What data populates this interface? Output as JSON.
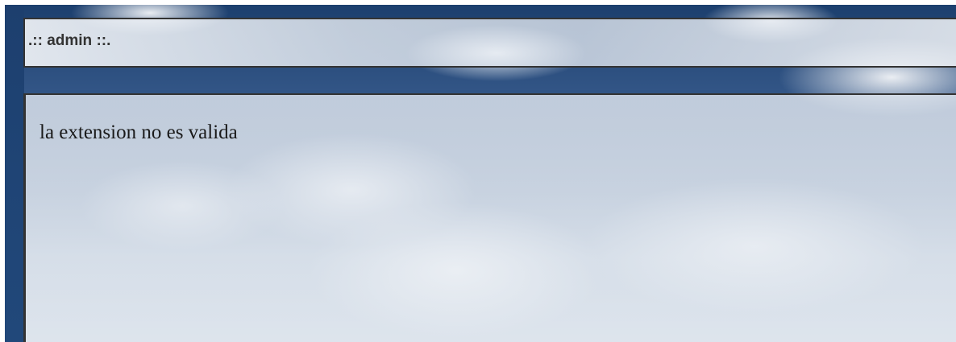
{
  "header": {
    "title": ".:: admin ::."
  },
  "content": {
    "message": "la extension no es valida"
  },
  "colors": {
    "border": "#333333",
    "sky_dark": "#1c3f6e",
    "panel_background": "#e0e6ee"
  }
}
